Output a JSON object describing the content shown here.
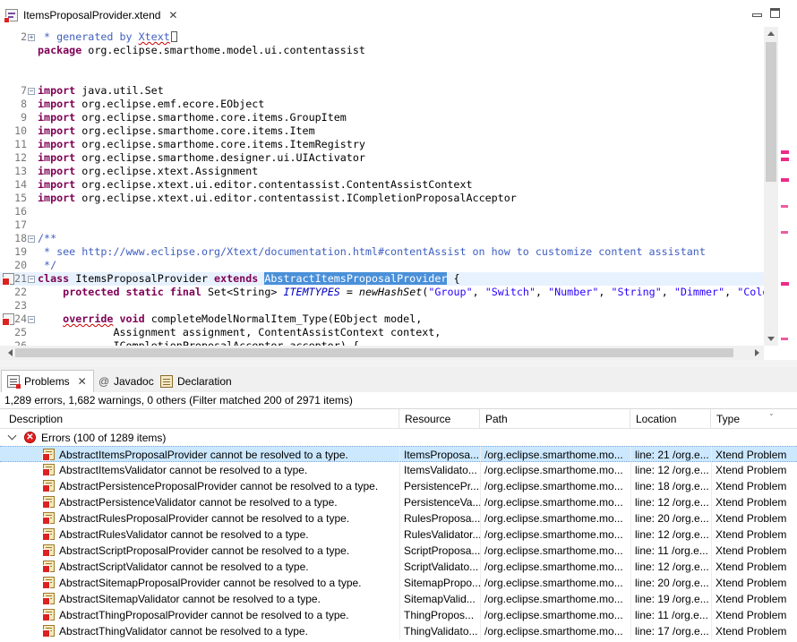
{
  "editor": {
    "tab_title": "ItemsProposalProvider.xtend",
    "lines": [
      {
        "num": "2",
        "fold": "collapsed",
        "marker": false,
        "segments": [
          {
            "c": "cm",
            "t": " * generated by "
          },
          {
            "c": "cm sq",
            "t": "Xtext"
          }
        ]
      },
      {
        "num": "",
        "fold": "",
        "marker": false,
        "segments": [
          {
            "c": "kw",
            "t": "package"
          },
          {
            "c": "",
            "t": " org.eclipse.smarthome.model.ui.contentassist"
          }
        ]
      },
      {
        "num": "",
        "fold": "",
        "marker": false,
        "segments": []
      },
      {
        "num": "",
        "fold": "",
        "marker": false,
        "segments": []
      },
      {
        "num": "7",
        "fold": "open",
        "marker": false,
        "segments": [
          {
            "c": "kw",
            "t": "import"
          },
          {
            "c": "",
            "t": " java.util.Set"
          }
        ]
      },
      {
        "num": "8",
        "fold": "",
        "marker": false,
        "segments": [
          {
            "c": "kw",
            "t": "import"
          },
          {
            "c": "",
            "t": " org.eclipse.emf.ecore.EObject"
          }
        ]
      },
      {
        "num": "9",
        "fold": "",
        "marker": false,
        "segments": [
          {
            "c": "kw",
            "t": "import"
          },
          {
            "c": "",
            "t": " org.eclipse.smarthome.core.items.GroupItem"
          }
        ]
      },
      {
        "num": "10",
        "fold": "",
        "marker": false,
        "segments": [
          {
            "c": "kw",
            "t": "import"
          },
          {
            "c": "",
            "t": " org.eclipse.smarthome.core.items.Item"
          }
        ]
      },
      {
        "num": "11",
        "fold": "",
        "marker": false,
        "segments": [
          {
            "c": "kw",
            "t": "import"
          },
          {
            "c": "",
            "t": " org.eclipse.smarthome.core.items.ItemRegistry"
          }
        ]
      },
      {
        "num": "12",
        "fold": "",
        "marker": false,
        "segments": [
          {
            "c": "kw",
            "t": "import"
          },
          {
            "c": "",
            "t": " org.eclipse.smarthome.designer.ui.UIActivator"
          }
        ]
      },
      {
        "num": "13",
        "fold": "",
        "marker": false,
        "segments": [
          {
            "c": "kw",
            "t": "import"
          },
          {
            "c": "",
            "t": " org.eclipse.xtext.Assignment"
          }
        ]
      },
      {
        "num": "14",
        "fold": "",
        "marker": false,
        "segments": [
          {
            "c": "kw",
            "t": "import"
          },
          {
            "c": "",
            "t": " org.eclipse.xtext.ui.editor.contentassist.ContentAssistContext"
          }
        ]
      },
      {
        "num": "15",
        "fold": "",
        "marker": false,
        "segments": [
          {
            "c": "kw",
            "t": "import"
          },
          {
            "c": "",
            "t": " org.eclipse.xtext.ui.editor.contentassist.ICompletionProposalAcceptor"
          }
        ]
      },
      {
        "num": "16",
        "fold": "",
        "marker": false,
        "segments": []
      },
      {
        "num": "17",
        "fold": "",
        "marker": false,
        "segments": []
      },
      {
        "num": "18",
        "fold": "open",
        "marker": false,
        "segments": [
          {
            "c": "cm",
            "t": "/**"
          }
        ]
      },
      {
        "num": "19",
        "fold": "",
        "marker": false,
        "segments": [
          {
            "c": "cm",
            "t": " * see http://www.eclipse.org/Xtext/documentation.html#contentAssist on how to customize content assistant"
          }
        ]
      },
      {
        "num": "20",
        "fold": "",
        "marker": false,
        "segments": [
          {
            "c": "cm",
            "t": " */"
          }
        ]
      },
      {
        "num": "21",
        "fold": "open",
        "marker": true,
        "highlight": true,
        "segments": [
          {
            "c": "kw",
            "t": "class"
          },
          {
            "c": "",
            "t": " ItemsProposalProvider "
          },
          {
            "c": "kw",
            "t": "extends"
          },
          {
            "c": "",
            "t": " "
          },
          {
            "c": "sel",
            "t": "AbstractItemsProposalProvider"
          },
          {
            "c": "",
            "t": " {"
          }
        ]
      },
      {
        "num": "22",
        "fold": "",
        "marker": false,
        "segments": [
          {
            "c": "",
            "t": "    "
          },
          {
            "c": "kw",
            "t": "protected static final"
          },
          {
            "c": "",
            "t": " Set<String> "
          },
          {
            "c": "it",
            "t": "ITEMTYPES"
          },
          {
            "c": "",
            "t": " = "
          },
          {
            "c": "it2",
            "t": "newHashSet"
          },
          {
            "c": "",
            "t": "("
          },
          {
            "c": "str",
            "t": "\"Group\""
          },
          {
            "c": "",
            "t": ", "
          },
          {
            "c": "str",
            "t": "\"Switch\""
          },
          {
            "c": "",
            "t": ", "
          },
          {
            "c": "str",
            "t": "\"Number\""
          },
          {
            "c": "",
            "t": ", "
          },
          {
            "c": "str",
            "t": "\"String\""
          },
          {
            "c": "",
            "t": ", "
          },
          {
            "c": "str",
            "t": "\"Dimmer\""
          },
          {
            "c": "",
            "t": ", "
          },
          {
            "c": "str",
            "t": "\"Colo"
          }
        ]
      },
      {
        "num": "23",
        "fold": "",
        "marker": false,
        "segments": []
      },
      {
        "num": "24",
        "fold": "open",
        "marker": true,
        "segments": [
          {
            "c": "",
            "t": "    "
          },
          {
            "c": "kw sq",
            "t": "override"
          },
          {
            "c": "",
            "t": " "
          },
          {
            "c": "kw",
            "t": "void"
          },
          {
            "c": "",
            "t": " completeModelNormalItem_Type(EObject model,"
          }
        ]
      },
      {
        "num": "25",
        "fold": "",
        "marker": false,
        "segments": [
          {
            "c": "",
            "t": "            Assignment assignment, ContentAssistContext context,"
          }
        ]
      },
      {
        "num": "26",
        "fold": "",
        "marker": false,
        "segments": [
          {
            "c": "",
            "t": "            ICompletionProposalAcceptor acceptor) {"
          }
        ]
      }
    ]
  },
  "views": {
    "tabs": [
      {
        "label": "Problems"
      },
      {
        "label": "Javadoc"
      },
      {
        "label": "Declaration"
      }
    ],
    "summary": "1,289 errors, 1,682 warnings, 0 others (Filter matched 200 of 2971 items)"
  },
  "problems": {
    "columns": [
      "Description",
      "Resource",
      "Path",
      "Location",
      "Type"
    ],
    "group_label": "Errors (100 of 1289 items)",
    "rows": [
      {
        "desc": "AbstractItemsProposalProvider cannot be resolved to a type.",
        "res": "ItemsProposa...",
        "path": "/org.eclipse.smarthome.mo...",
        "loc": "line: 21 /org.e...",
        "type": "Xtend Problem"
      },
      {
        "desc": "AbstractItemsValidator cannot be resolved to a type.",
        "res": "ItemsValidato...",
        "path": "/org.eclipse.smarthome.mo...",
        "loc": "line: 12 /org.e...",
        "type": "Xtend Problem"
      },
      {
        "desc": "AbstractPersistenceProposalProvider cannot be resolved to a type.",
        "res": "PersistencePr...",
        "path": "/org.eclipse.smarthome.mo...",
        "loc": "line: 18 /org.e...",
        "type": "Xtend Problem"
      },
      {
        "desc": "AbstractPersistenceValidator cannot be resolved to a type.",
        "res": "PersistenceVa...",
        "path": "/org.eclipse.smarthome.mo...",
        "loc": "line: 12 /org.e...",
        "type": "Xtend Problem"
      },
      {
        "desc": "AbstractRulesProposalProvider cannot be resolved to a type.",
        "res": "RulesProposa...",
        "path": "/org.eclipse.smarthome.mo...",
        "loc": "line: 20 /org.e...",
        "type": "Xtend Problem"
      },
      {
        "desc": "AbstractRulesValidator cannot be resolved to a type.",
        "res": "RulesValidator...",
        "path": "/org.eclipse.smarthome.mo...",
        "loc": "line: 12 /org.e...",
        "type": "Xtend Problem"
      },
      {
        "desc": "AbstractScriptProposalProvider cannot be resolved to a type.",
        "res": "ScriptProposa...",
        "path": "/org.eclipse.smarthome.mo...",
        "loc": "line: 11 /org.e...",
        "type": "Xtend Problem"
      },
      {
        "desc": "AbstractScriptValidator cannot be resolved to a type.",
        "res": "ScriptValidato...",
        "path": "/org.eclipse.smarthome.mo...",
        "loc": "line: 12 /org.e...",
        "type": "Xtend Problem"
      },
      {
        "desc": "AbstractSitemapProposalProvider cannot be resolved to a type.",
        "res": "SitemapPropo...",
        "path": "/org.eclipse.smarthome.mo...",
        "loc": "line: 20 /org.e...",
        "type": "Xtend Problem"
      },
      {
        "desc": "AbstractSitemapValidator cannot be resolved to a type.",
        "res": "SitemapValid...",
        "path": "/org.eclipse.smarthome.mo...",
        "loc": "line: 19 /org.e...",
        "type": "Xtend Problem"
      },
      {
        "desc": "AbstractThingProposalProvider cannot be resolved to a type.",
        "res": "ThingPropos...",
        "path": "/org.eclipse.smarthome.mo...",
        "loc": "line: 11 /org.e...",
        "type": "Xtend Problem"
      },
      {
        "desc": "AbstractThingValidator cannot be resolved to a type.",
        "res": "ThingValidato...",
        "path": "/org.eclipse.smarthome.mo...",
        "loc": "line: 17 /org.e...",
        "type": "Xtend Problem"
      }
    ]
  },
  "colors": {
    "keyword": "#7f0055",
    "comment": "#3f5fbf",
    "string": "#2a00ff",
    "selection": "#4a90d9",
    "row_selected": "#cce8ff",
    "error": "#e02020"
  }
}
